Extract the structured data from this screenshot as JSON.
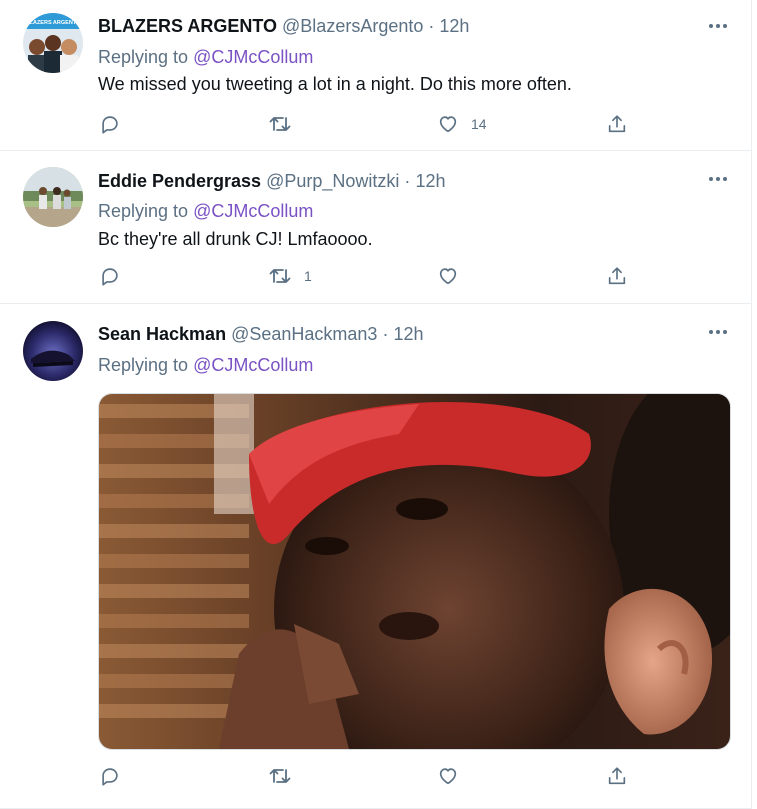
{
  "tweets": [
    {
      "name": "BLAZERS ARGENTO",
      "handle": "@BlazersArgento",
      "dot": "·",
      "time": "12h",
      "replying_prefix": "Replying to ",
      "replying_to": "@CJMcCollum",
      "text": "We missed you tweeting a lot in a night. Do this more often.",
      "reply_count": "",
      "retweet_count": "",
      "like_count": "14",
      "avatar_text": "BLAZERS ARGENTO"
    },
    {
      "name": "Eddie Pendergrass",
      "handle": "@Purp_Nowitzki",
      "dot": "·",
      "time": "12h",
      "replying_prefix": "Replying to ",
      "replying_to": "@CJMcCollum",
      "text": "Bc they're all drunk CJ! Lmfaoooo.",
      "reply_count": "",
      "retweet_count": "1",
      "like_count": ""
    },
    {
      "name": "Sean Hackman",
      "handle": "@SeanHackman3",
      "dot": "·",
      "time": "12h",
      "replying_prefix": "Replying to ",
      "replying_to": "@CJMcCollum",
      "text": "",
      "reply_count": "",
      "retweet_count": "",
      "like_count": "",
      "media": "photo of a man in a red bandana holding a hand to his ear"
    }
  ],
  "colors": {
    "name": "#0f1419",
    "secondary": "#5b7083",
    "mention": "#7a52c4",
    "divider": "#ebeef0"
  },
  "icons": [
    "reply-icon",
    "retweet-icon",
    "like-icon",
    "share-icon",
    "more-options-icon"
  ]
}
